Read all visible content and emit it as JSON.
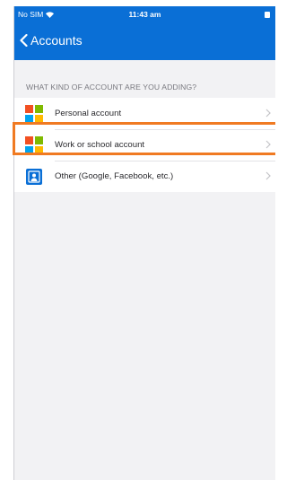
{
  "status_bar": {
    "carrier": "No SIM",
    "time": "11:43 am"
  },
  "nav": {
    "back_label": "Accounts"
  },
  "section": {
    "header": "WHAT KIND OF ACCOUNT ARE YOU ADDING?"
  },
  "accounts": [
    {
      "label": "Personal account",
      "icon": "microsoft-logo-icon"
    },
    {
      "label": "Work or school account",
      "icon": "microsoft-logo-icon",
      "highlighted": true
    },
    {
      "label": "Other (Google, Facebook, etc.)",
      "icon": "person-contact-icon"
    }
  ],
  "colors": {
    "nav_blue": "#0a6fd6",
    "highlight_orange": "#f07a22"
  }
}
